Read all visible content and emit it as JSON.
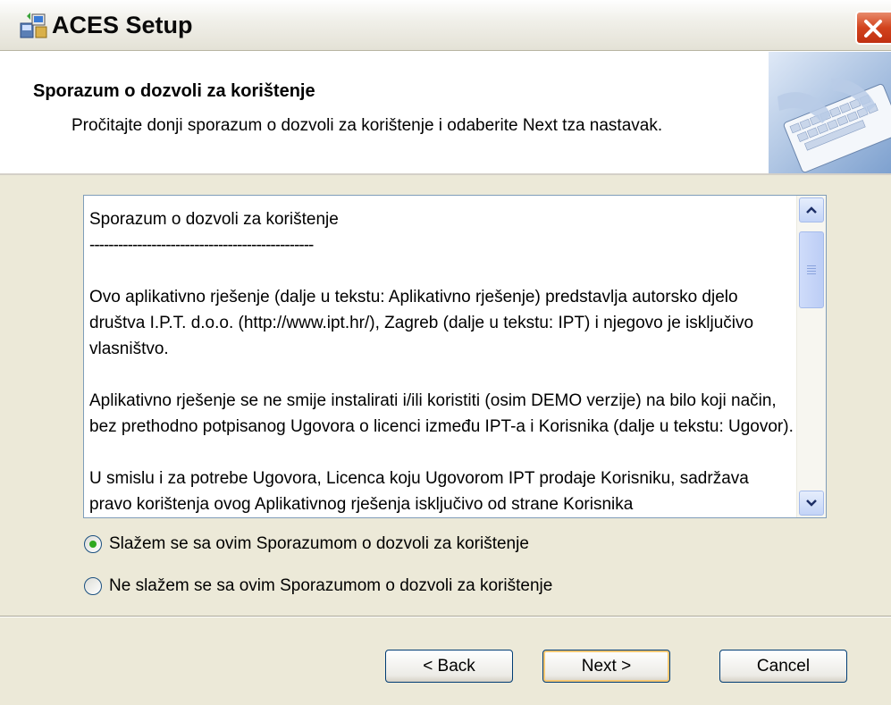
{
  "window": {
    "title": "ACES Setup",
    "app_icon": "setup-computer-icon",
    "close_icon": "close-icon"
  },
  "header": {
    "title": "Sporazum o dozvoli za korištenje",
    "description": "Pročitajte donji sporazum o dozvoli za korištenje i odaberite Next tza nastavak.",
    "image": "keyboard-hands-image"
  },
  "license": {
    "title": "Sporazum o dozvoli za korištenje",
    "separator": "-----------------------------------------------",
    "paragraphs": [
      "Ovo aplikativno rješenje (dalje u tekstu: Aplikativno rješenje) predstavlja autorsko djelo društva I.P.T. d.o.o. (http://www.ipt.hr/), Zagreb (dalje u tekstu: IPT) i njegovo je isključivo vlasništvo.",
      "Aplikativno rješenje se ne smije instalirati i/ili koristiti (osim DEMO verzije) na bilo koji način, bez prethodno potpisanog Ugovora o licenci između IPT-a i Korisnika (dalje u tekstu: Ugovor).",
      "U smislu i za potrebe Ugovora, Licenca koju Ugovorom IPT prodaje Korisniku, sadržava pravo korištenja ovog Aplikativnog rješenja isključivo od strane Korisnika"
    ],
    "scroll_up_icon": "scroll-up-arrow-icon",
    "scroll_down_icon": "scroll-down-arrow-icon"
  },
  "options": {
    "accept": "Slažem se sa ovim Sporazumom o dozvoli za korištenje",
    "decline": "Ne slažem se sa ovim Sporazumom o dozvoli za korištenje",
    "selected": "accept"
  },
  "buttons": {
    "back": "< Back",
    "next": "Next >",
    "cancel": "Cancel"
  },
  "colors": {
    "dialog_bg": "#ece9d8",
    "close_red": "#d2431d",
    "radio_selected": "#2fa81f",
    "default_button_highlight": "#f7c873"
  }
}
